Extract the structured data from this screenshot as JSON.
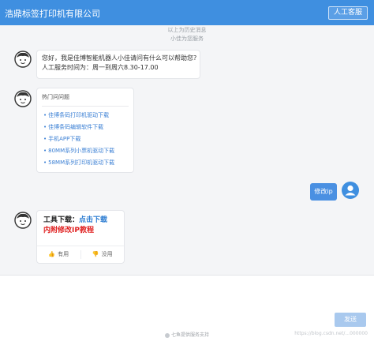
{
  "header": {
    "title": "浩鼎标签打印机有限公司",
    "human_service_label": "人工客服"
  },
  "chat": {
    "history_hint": "以上为历史消息",
    "service_hint": "小佳为您服务",
    "greeting": {
      "line1": "您好，我是佳博智能机器人小佳请问有什么可以帮助您?",
      "line2": "人工服务时间为：周一到周六8.30-17.00"
    },
    "hot_questions": {
      "title": "热门问问题",
      "items": [
        "佳博条码打印机驱动下载",
        "佳博条码编辑软件下载",
        "手机APP下载",
        "80MM系列小票机驱动下载",
        "58MM系列打印机驱动下载"
      ]
    },
    "user_message": "修改ip",
    "download_reply": {
      "label": "工具下载：",
      "link": "点击下载",
      "note": "内附修改IP教程",
      "useful_label": "有用",
      "useless_label": "没用"
    }
  },
  "input": {
    "placeholder": "",
    "send_label": "发送",
    "powered_by": "七鱼提供服务支持",
    "watermark": "https://blog.csdn.net/...000000"
  },
  "colors": {
    "brand": "#3f8fe0",
    "link": "#2d7dd2",
    "alert": "#e02020"
  }
}
